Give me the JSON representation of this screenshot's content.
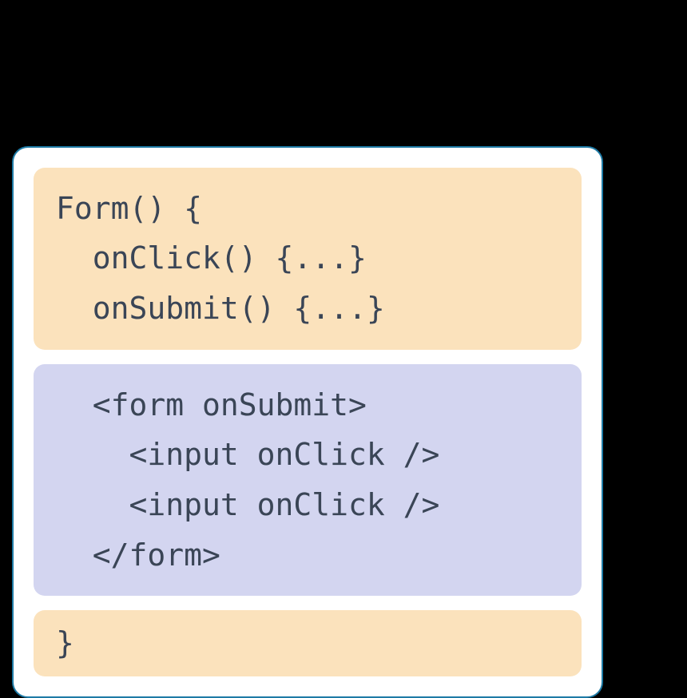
{
  "blocks": {
    "top": {
      "line1": "Form() {",
      "line2": "  onClick() {...}",
      "line3": "  onSubmit() {...}"
    },
    "middle": {
      "line1": "  <form onSubmit>",
      "line2": "    <input onClick />",
      "line3": "    <input onClick />",
      "line4": "  </form>"
    },
    "bottom": {
      "line1": "}"
    }
  }
}
